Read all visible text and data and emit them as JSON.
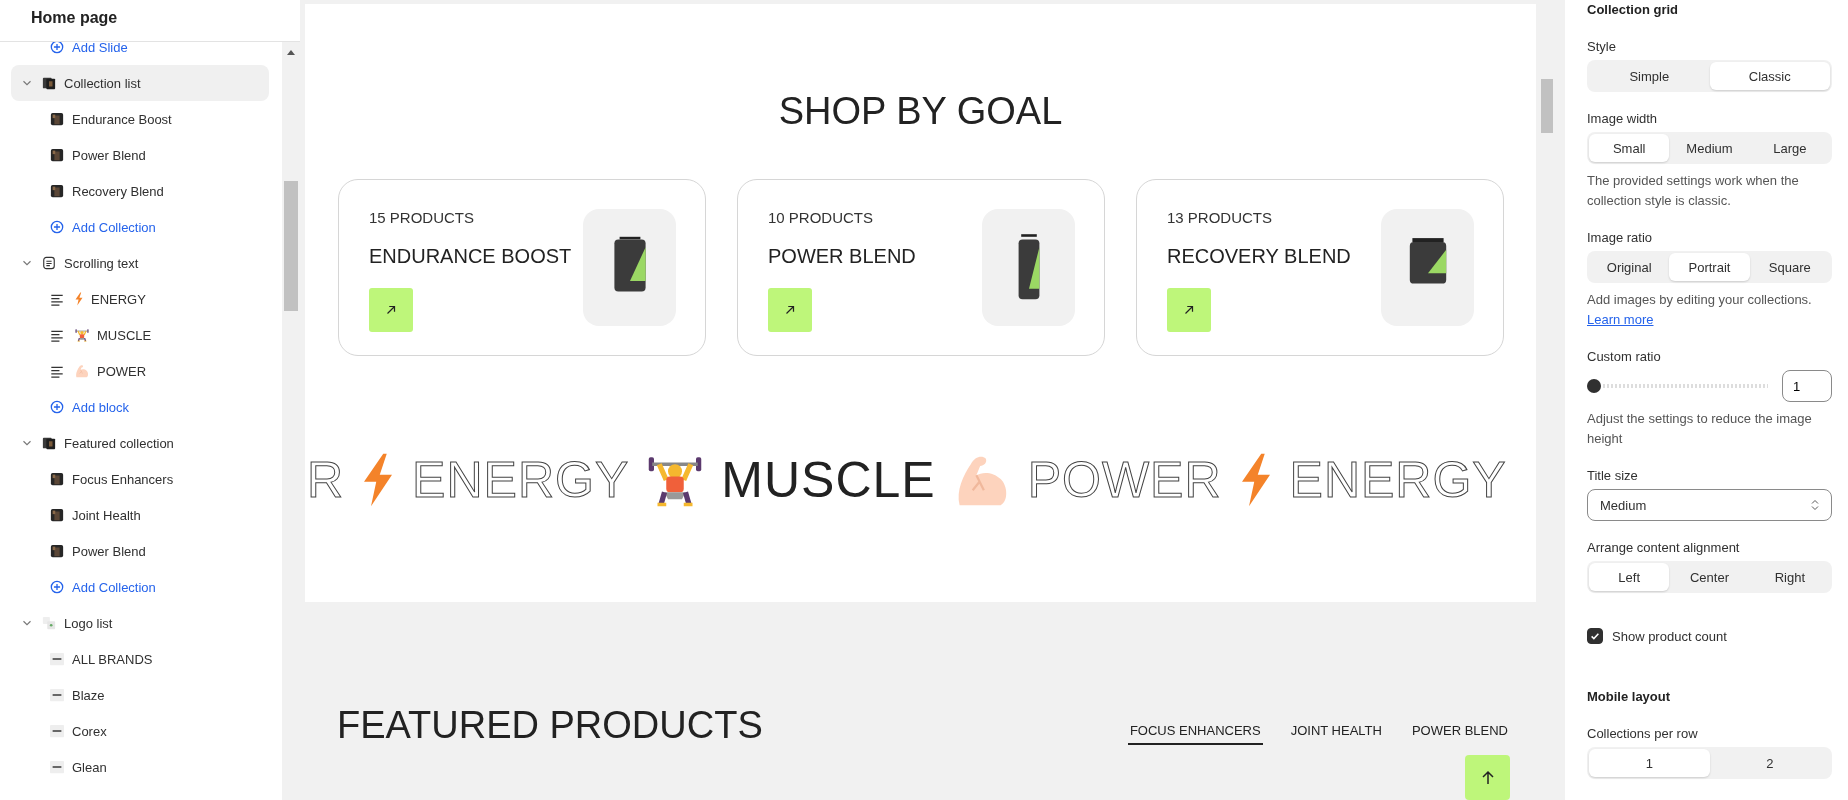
{
  "sidebar": {
    "title": "Home page",
    "items": [
      {
        "kind": "add",
        "label": "Add Slide"
      },
      {
        "kind": "images",
        "label": "Collection list",
        "expanded": true,
        "selected": true,
        "children": [
          {
            "kind": "image",
            "label": "Endurance Boost"
          },
          {
            "kind": "image",
            "label": "Power Blend"
          },
          {
            "kind": "image",
            "label": "Recovery Blend"
          },
          {
            "kind": "add",
            "label": "Add Collection"
          }
        ]
      },
      {
        "kind": "text",
        "label": "Scrolling text",
        "expanded": true,
        "selected": false,
        "children": [
          {
            "kind": "text",
            "label": "ENERGY"
          },
          {
            "kind": "text",
            "label": "MUSCLE"
          },
          {
            "kind": "text",
            "label": "POWER"
          },
          {
            "kind": "add",
            "label": "Add block"
          }
        ]
      },
      {
        "kind": "images",
        "label": "Featured collection",
        "expanded": true,
        "selected": false,
        "children": [
          {
            "kind": "image",
            "label": "Focus Enhancers"
          },
          {
            "kind": "image",
            "label": "Joint Health"
          },
          {
            "kind": "image",
            "label": "Power Blend"
          },
          {
            "kind": "add",
            "label": "Add Collection"
          }
        ]
      },
      {
        "kind": "logos",
        "label": "Logo list",
        "expanded": true,
        "selected": false,
        "children": [
          {
            "kind": "logo",
            "label": "ALL BRANDS"
          },
          {
            "kind": "logo",
            "label": "Blaze"
          },
          {
            "kind": "logo",
            "label": "Corex"
          },
          {
            "kind": "logo",
            "label": "Glean"
          }
        ]
      }
    ]
  },
  "preview": {
    "heading": "SHOP BY GOAL",
    "cards": [
      {
        "count": "15 PRODUCTS",
        "title": "ENDURANCE BOOST"
      },
      {
        "count": "10 PRODUCTS",
        "title": "POWER BLEND"
      },
      {
        "count": "13 PRODUCTS",
        "title": "RECOVERY BLEND"
      }
    ],
    "marquee": [
      {
        "text": "R",
        "outlined": true
      },
      {
        "text": "ENERGY",
        "outlined": true
      },
      {
        "text": "MUSCLE",
        "outlined": false
      },
      {
        "text": "POWER",
        "outlined": true
      },
      {
        "text": "ENERGY",
        "outlined": true
      }
    ],
    "featured": {
      "title": "FEATURED PRODUCTS",
      "tabs": [
        {
          "label": "FOCUS ENHANCERS",
          "selected": true
        },
        {
          "label": "JOINT HEALTH",
          "selected": false
        },
        {
          "label": "POWER BLEND",
          "selected": false
        }
      ]
    }
  },
  "settings": [
    {
      "kind": "heading",
      "label": "Collection grid"
    },
    {
      "kind": "segmented",
      "label": "Style",
      "options": [
        {
          "label": "Simple",
          "selected": false
        },
        {
          "label": "Classic",
          "selected": true
        }
      ]
    },
    {
      "kind": "segmented",
      "label": "Image width",
      "options": [
        {
          "label": "Small",
          "selected": true
        },
        {
          "label": "Medium",
          "selected": false
        },
        {
          "label": "Large",
          "selected": false
        }
      ],
      "help": "The provided settings work when the collection style is classic."
    },
    {
      "kind": "segmented",
      "label": "Image ratio",
      "options": [
        {
          "label": "Original",
          "selected": false
        },
        {
          "label": "Portrait",
          "selected": true
        },
        {
          "label": "Square",
          "selected": false
        }
      ],
      "help": "Add images by editing your collections.",
      "link": "Learn more"
    },
    {
      "kind": "range",
      "label": "Custom ratio",
      "level": 0,
      "value": "1",
      "help": "Adjust the settings to reduce the image height"
    },
    {
      "kind": "select",
      "label": "Title size",
      "value": "Medium"
    },
    {
      "kind": "segmented",
      "label": "Arrange content alignment",
      "options": [
        {
          "label": "Left",
          "selected": true
        },
        {
          "label": "Center",
          "selected": false
        },
        {
          "label": "Right",
          "selected": false
        }
      ]
    },
    {
      "kind": "checkbox",
      "label": "Show product count",
      "checked": true
    },
    {
      "kind": "heading",
      "label": "Mobile layout"
    },
    {
      "kind": "segmented",
      "label": "Collections per row",
      "options": [
        {
          "label": "1",
          "selected": true
        },
        {
          "label": "2",
          "selected": false
        }
      ]
    }
  ]
}
